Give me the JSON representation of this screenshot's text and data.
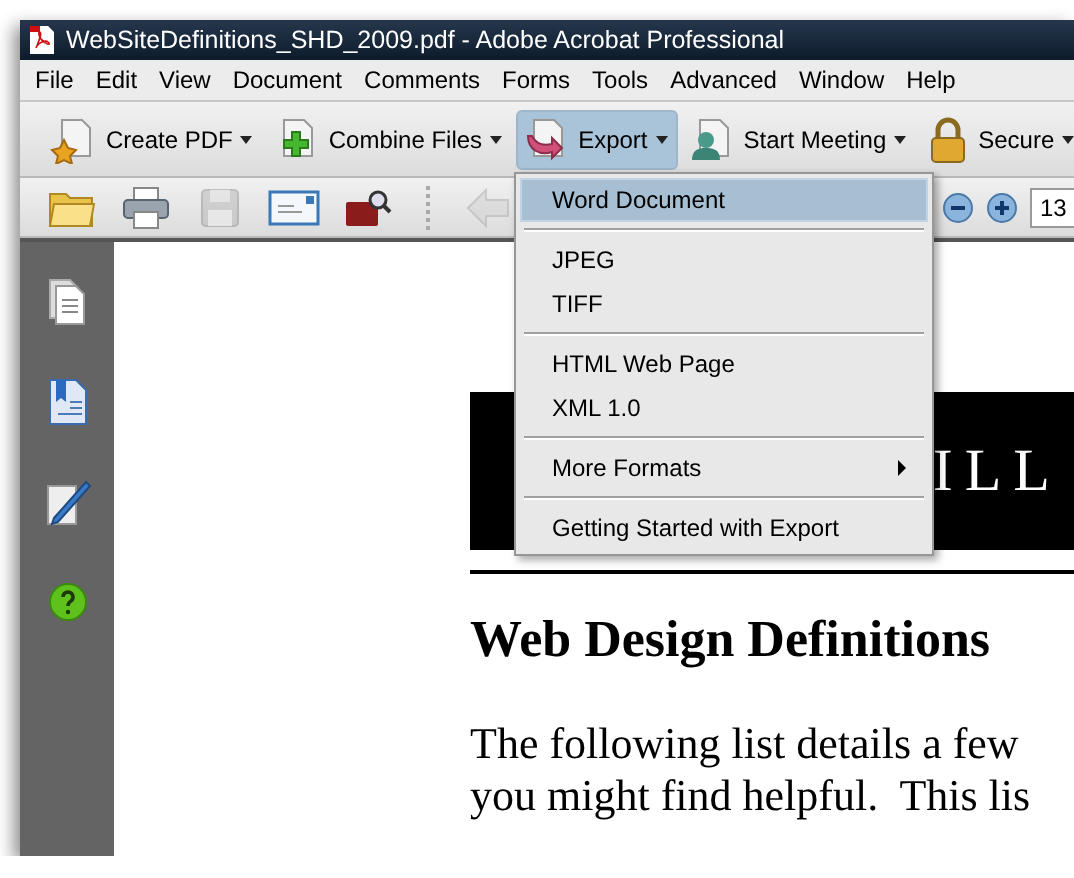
{
  "window": {
    "title": "WebSiteDefinitions_SHD_2009.pdf - Adobe Acrobat Professional"
  },
  "menu_bar": [
    "File",
    "Edit",
    "View",
    "Document",
    "Comments",
    "Forms",
    "Tools",
    "Advanced",
    "Window",
    "Help"
  ],
  "task_buttons": [
    {
      "kind": "create",
      "label": "Create PDF",
      "selected": false
    },
    {
      "kind": "combine",
      "label": "Combine Files",
      "selected": false
    },
    {
      "kind": "export",
      "label": "Export",
      "selected": true
    },
    {
      "kind": "meeting",
      "label": "Start Meeting",
      "selected": false
    },
    {
      "kind": "secure",
      "label": "Secure",
      "selected": false
    }
  ],
  "tools": [
    {
      "kind": "open",
      "disabled": false
    },
    {
      "kind": "print",
      "disabled": false
    },
    {
      "kind": "save",
      "disabled": true
    },
    {
      "kind": "email",
      "disabled": false
    },
    {
      "kind": "bridge",
      "disabled": false
    },
    {
      "kind": "separator"
    },
    {
      "kind": "back",
      "disabled": true
    }
  ],
  "zoom": {
    "value": "13"
  },
  "sidebar": [
    {
      "kind": "pages"
    },
    {
      "kind": "bookmarks"
    },
    {
      "kind": "signatures"
    },
    {
      "kind": "help"
    }
  ],
  "export_menu": [
    {
      "kind": "item",
      "label": "Word Document",
      "selected": true
    },
    {
      "kind": "separator"
    },
    {
      "kind": "item",
      "label": "JPEG",
      "selected": false
    },
    {
      "kind": "item",
      "label": "TIFF",
      "selected": false
    },
    {
      "kind": "separator"
    },
    {
      "kind": "item",
      "label": "HTML Web Page",
      "selected": false
    },
    {
      "kind": "item",
      "label": "XML 1.0",
      "selected": false
    },
    {
      "kind": "separator"
    },
    {
      "kind": "submenu",
      "label": "More Formats",
      "selected": false
    },
    {
      "kind": "separator"
    },
    {
      "kind": "item",
      "label": "Getting Started with Export",
      "selected": false
    }
  ],
  "document": {
    "banner_text": "ILL",
    "heading": "Web Design Definitions",
    "paragraph_lines": [
      "The following list details a few",
      "you might find helpful.  This lis"
    ]
  }
}
